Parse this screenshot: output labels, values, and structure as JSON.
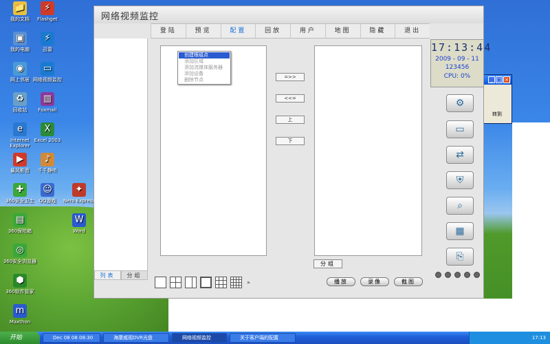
{
  "desktop": {
    "icons": [
      {
        "label": "我的文档",
        "icon": "folder-icon",
        "color": "#e8c040"
      },
      {
        "label": "我的电脑",
        "icon": "computer-icon",
        "color": "#5a8fd0"
      },
      {
        "label": "网上邻居",
        "icon": "network-icon",
        "color": "#4a9ad8"
      },
      {
        "label": "回收站",
        "icon": "recycle-bin-icon",
        "color": "#6aa0c8"
      },
      {
        "label": "Internet Explorer",
        "icon": "ie-icon",
        "color": "#2a78d0"
      },
      {
        "label": "暴风影音",
        "icon": "media-icon",
        "color": "#d03a2a"
      },
      {
        "label": "360安全卫士",
        "icon": "shield-icon",
        "color": "#3aa83a"
      },
      {
        "label": "360保险箱",
        "icon": "safe-icon",
        "color": "#3aa83a"
      },
      {
        "label": "360安全浏览器",
        "icon": "browser-icon",
        "color": "#3aa83a"
      },
      {
        "label": "360软件管家",
        "icon": "software-icon",
        "color": "#2a8a2a"
      },
      {
        "label": "Maxthon",
        "icon": "maxthon-icon",
        "color": "#2a5ad0"
      },
      {
        "label": "Flashget",
        "icon": "flashget-icon",
        "color": "#d03a2a"
      },
      {
        "label": "迅雷",
        "icon": "thunder-icon",
        "color": "#1a7ad0"
      },
      {
        "label": "网络视频监控",
        "icon": "monitor-icon",
        "color": "#1a7ad0"
      },
      {
        "label": "Foxmail",
        "icon": "archive-icon",
        "color": "#8a3a9a"
      },
      {
        "label": "Excel 2003",
        "icon": "excel-icon",
        "color": "#2a8a3a"
      },
      {
        "label": "千千静听",
        "icon": "music-icon",
        "color": "#d08a3a"
      },
      {
        "label": "QQ游戏",
        "icon": "qq-icon",
        "color": "#3a6ad0"
      },
      {
        "label": "Nero Express",
        "icon": "nero-icon",
        "color": "#c03a2a"
      },
      {
        "label": "Word",
        "icon": "word-icon",
        "color": "#2a5ad0"
      }
    ]
  },
  "bg_window": {
    "play_label": "转到",
    "min": "_",
    "max": "□",
    "close": "×"
  },
  "app": {
    "title": "网络视频监控",
    "menu": [
      "登陆",
      "预览",
      "配置",
      "回放",
      "用户",
      "地图",
      "隐藏",
      "退出"
    ],
    "active_menu": "配置",
    "left_tabs": [
      "列表",
      "分组"
    ],
    "context_menu": [
      "创建根组点",
      "添加区域",
      "添加流媒体服务器",
      "添加设备",
      "删除节点"
    ],
    "mid_buttons": [
      "=>>",
      "<<=",
      "上",
      "下"
    ],
    "group_button": "分组",
    "clock": {
      "time": "17:13:44",
      "date": "2009 - 09 - 11",
      "id": "123456",
      "cpu": "CPU:  0%"
    },
    "tools": [
      "config-tool-icon",
      "monitor-tool-icon",
      "network-tool-icon",
      "security-tool-icon",
      "search-tool-icon",
      "board-tool-icon",
      "export-tool-icon"
    ],
    "layout_more": "»",
    "bottom_buttons": [
      "播放",
      "录像",
      "截图"
    ]
  },
  "taskbar": {
    "start": "开始",
    "tasks": [
      "Dec 08 08 08:30",
      "海康威视DVR光盘",
      "网络视频监控",
      "关于客户端的配置"
    ],
    "active_task": "网络视频监控",
    "time": "17:13"
  }
}
